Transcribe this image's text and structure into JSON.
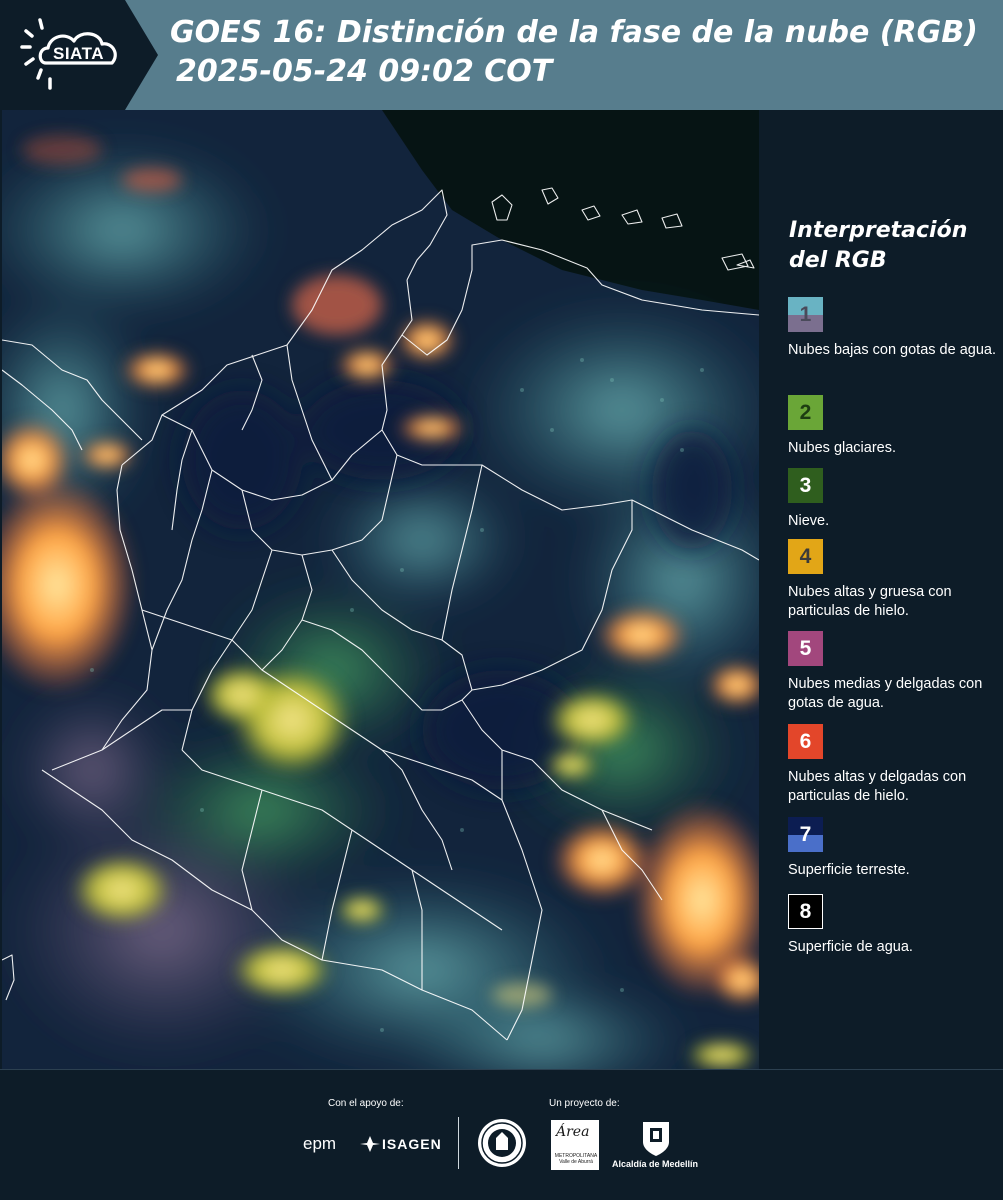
{
  "header": {
    "logo_text": "SIATA",
    "title": "GOES 16: Distinción de la fase de la nube (RGB)",
    "timestamp": "2025-05-24 09:02 COT"
  },
  "legend": {
    "title_line1": "Interpretación",
    "title_line2": "del RGB",
    "items": [
      {
        "number": "1",
        "label": "Nubes bajas con gotas de agua.",
        "color_top": "#69b3c3",
        "color_bottom": "#7b6f8f",
        "number_color": "#4a4a5a"
      },
      {
        "number": "2",
        "label": "Nubes glaciares.",
        "color": "#6aa637",
        "number_color": "#1d3d12"
      },
      {
        "number": "3",
        "label": "Nieve.",
        "color": "#2f5e1e",
        "number_color": "#ffffff"
      },
      {
        "number": "4",
        "label": "Nubes altas y gruesa con particulas de hielo.",
        "color": "#e2a617",
        "number_color": "#3a3a3a"
      },
      {
        "number": "5",
        "label": "Nubes medias y delgadas con gotas de agua.",
        "color": "#a2477d",
        "number_color": "#ffffff"
      },
      {
        "number": "6",
        "label": "Nubes altas y delgadas con particulas de hielo.",
        "color": "#e3462a",
        "number_color": "#ffffff"
      },
      {
        "number": "7",
        "label": "Superficie terreste.",
        "color_top": "#0c1d52",
        "color_bottom": "#4a6fc9",
        "number_color": "#ffffff"
      },
      {
        "number": "8",
        "label": "Superficie de agua.",
        "color": "#000000",
        "number_color": "#ffffff"
      }
    ]
  },
  "footer": {
    "support_label": "Con el apoyo de:",
    "project_label": "Un proyecto de:",
    "sponsor_1": "epm",
    "sponsor_2": "ISAGEN",
    "partner_area_script": "Área",
    "partner_area_small": "METROPOLITANA Valle de Aburrá",
    "partner_alcaldia": "Alcaldía de Medellín"
  },
  "colors": {
    "header_bg": "#577d8d",
    "panel_bg": "#0d1c28",
    "border_lines": "#ffffff"
  },
  "icons": [
    "sun-cloud-logo-icon",
    "isagen-logo-icon",
    "university-seal-icon",
    "alcaldia-shield-icon"
  ]
}
